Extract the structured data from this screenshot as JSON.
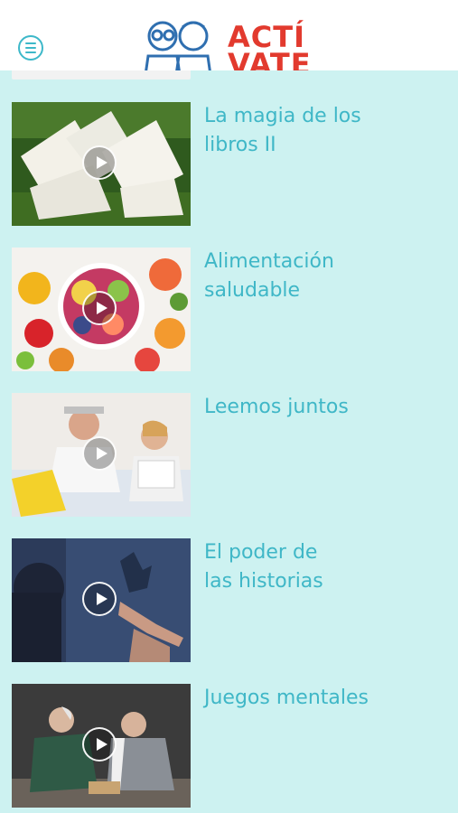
{
  "header": {
    "menu_icon": "hamburger-menu-icon",
    "logo_text_line1": "ACTÍ",
    "logo_text_line2": "VATE"
  },
  "colors": {
    "accent": "#3fb7c7",
    "background": "#cdf2f1",
    "brand_red": "#e23a2e"
  },
  "items": [
    {
      "title_line1": "La magia de los",
      "title_line2": "libros II",
      "thumbnail": "open-books-on-grass",
      "play_icon": "play-icon"
    },
    {
      "title_line1": "Alimentación",
      "title_line2": "saludable",
      "thumbnail": "fruit-bowl",
      "play_icon": "play-icon"
    },
    {
      "title_line1": "Leemos juntos",
      "title_line2": "",
      "thumbnail": "couple-reading-in-bed",
      "play_icon": "play-icon"
    },
    {
      "title_line1": "El poder de",
      "title_line2": "las historias",
      "thumbnail": "hand-shadow-puppets",
      "play_icon": "play-icon"
    },
    {
      "title_line1": "Juegos mentales",
      "title_line2": "",
      "thumbnail": "men-playing-chess",
      "play_icon": "play-icon"
    }
  ]
}
